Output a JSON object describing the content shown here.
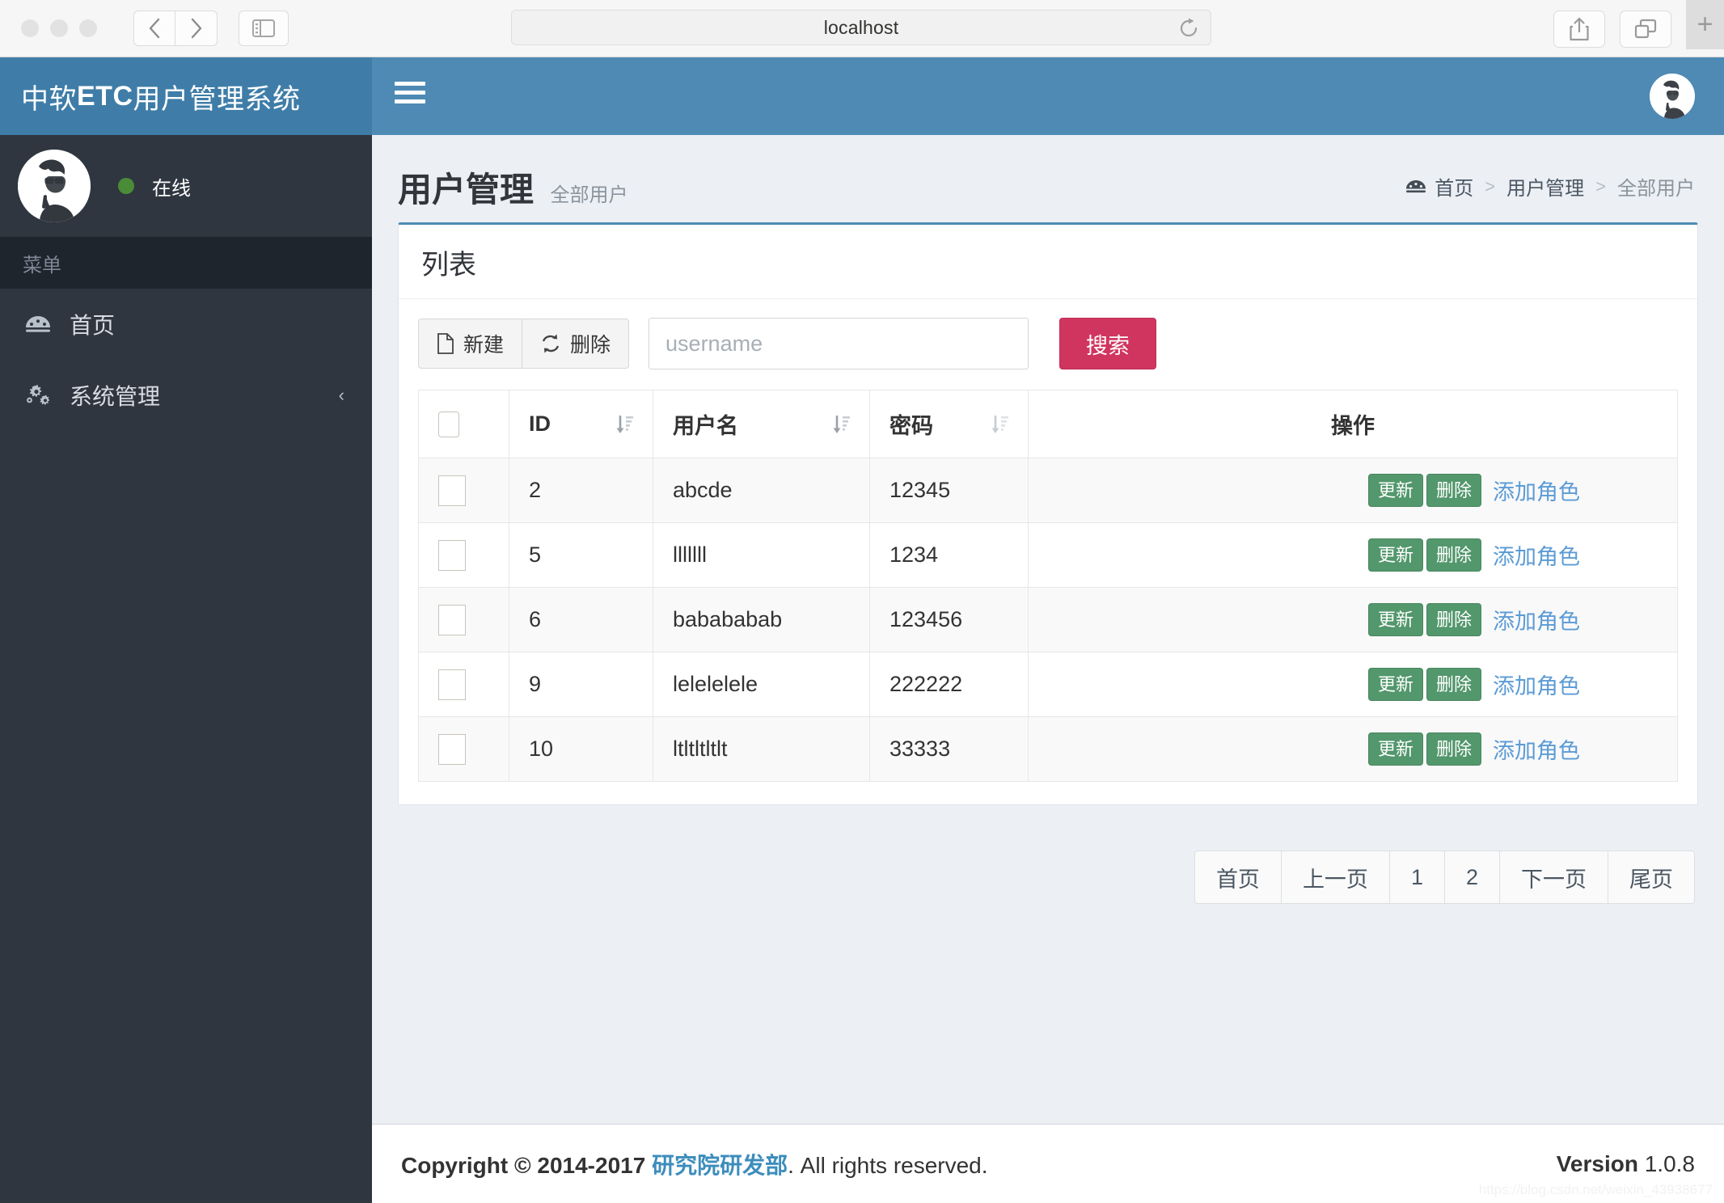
{
  "browser": {
    "url": "localhost",
    "reload_icon": "reload-icon",
    "back_icon": "chevron-left-icon",
    "forward_icon": "chevron-right-icon",
    "sidebar_icon": "sidebar-toggle-icon",
    "share_icon": "share-icon",
    "tabs_icon": "tab-overview-icon",
    "newtab_label": "+"
  },
  "brand": {
    "prefix": "中软",
    "strong": "ETC",
    "suffix": "用户管理系统"
  },
  "navbar": {
    "menu_toggle_icon": "hamburger-icon",
    "avatar_icon": "user-avatar"
  },
  "sidebar": {
    "user": {
      "avatar_icon": "user-avatar",
      "status_label": "在线",
      "status_color": "#4a8b38"
    },
    "menu_header": "菜单",
    "items": [
      {
        "label": "首页",
        "icon": "dashboard-icon",
        "caret": ""
      },
      {
        "label": "系统管理",
        "icon": "gears-icon",
        "caret": "‹"
      }
    ]
  },
  "page": {
    "title": "用户管理",
    "subtitle": "全部用户",
    "breadcrumb": {
      "icon": "dashboard-icon",
      "home": "首页",
      "sep": ">",
      "level2": "用户管理",
      "level3": "全部用户"
    }
  },
  "panel": {
    "title": "列表",
    "accent_color": "#4e8ab4",
    "toolbar": {
      "new_label": "新建",
      "new_icon": "file-icon",
      "delete_label": "删除",
      "delete_icon": "refresh-icon",
      "search_placeholder": "username",
      "search_value": "",
      "search_button_label": "搜索",
      "search_button_color": "#d0355f"
    },
    "table": {
      "columns": [
        "",
        "ID",
        "用户名",
        "密码",
        "操作"
      ],
      "sort_icon": "sort-amount-desc-icon",
      "row_actions": {
        "update_label": "更新",
        "delete_label": "删除",
        "add_role_label": "添加角色",
        "button_color": "#53976c",
        "link_color": "#5b9bd5"
      },
      "rows": [
        {
          "id": "2",
          "username": "abcde",
          "password": "12345"
        },
        {
          "id": "5",
          "username": "lllllll",
          "password": "1234"
        },
        {
          "id": "6",
          "username": "babababab",
          "password": "123456"
        },
        {
          "id": "9",
          "username": "lelelelele",
          "password": "222222"
        },
        {
          "id": "10",
          "username": "ltltltltlt",
          "password": "33333"
        }
      ]
    }
  },
  "pagination": {
    "items": [
      "首页",
      "上一页",
      "1",
      "2",
      "下一页",
      "尾页"
    ]
  },
  "footer": {
    "copyright_strong": "Copyright © 2014-2017",
    "dept_link": "研究院研发部",
    "rights": ". All rights reserved.",
    "version_label": "Version",
    "version_number": "1.0.8",
    "watermark": "https://blog.csdn.net/weixin_43938677"
  }
}
